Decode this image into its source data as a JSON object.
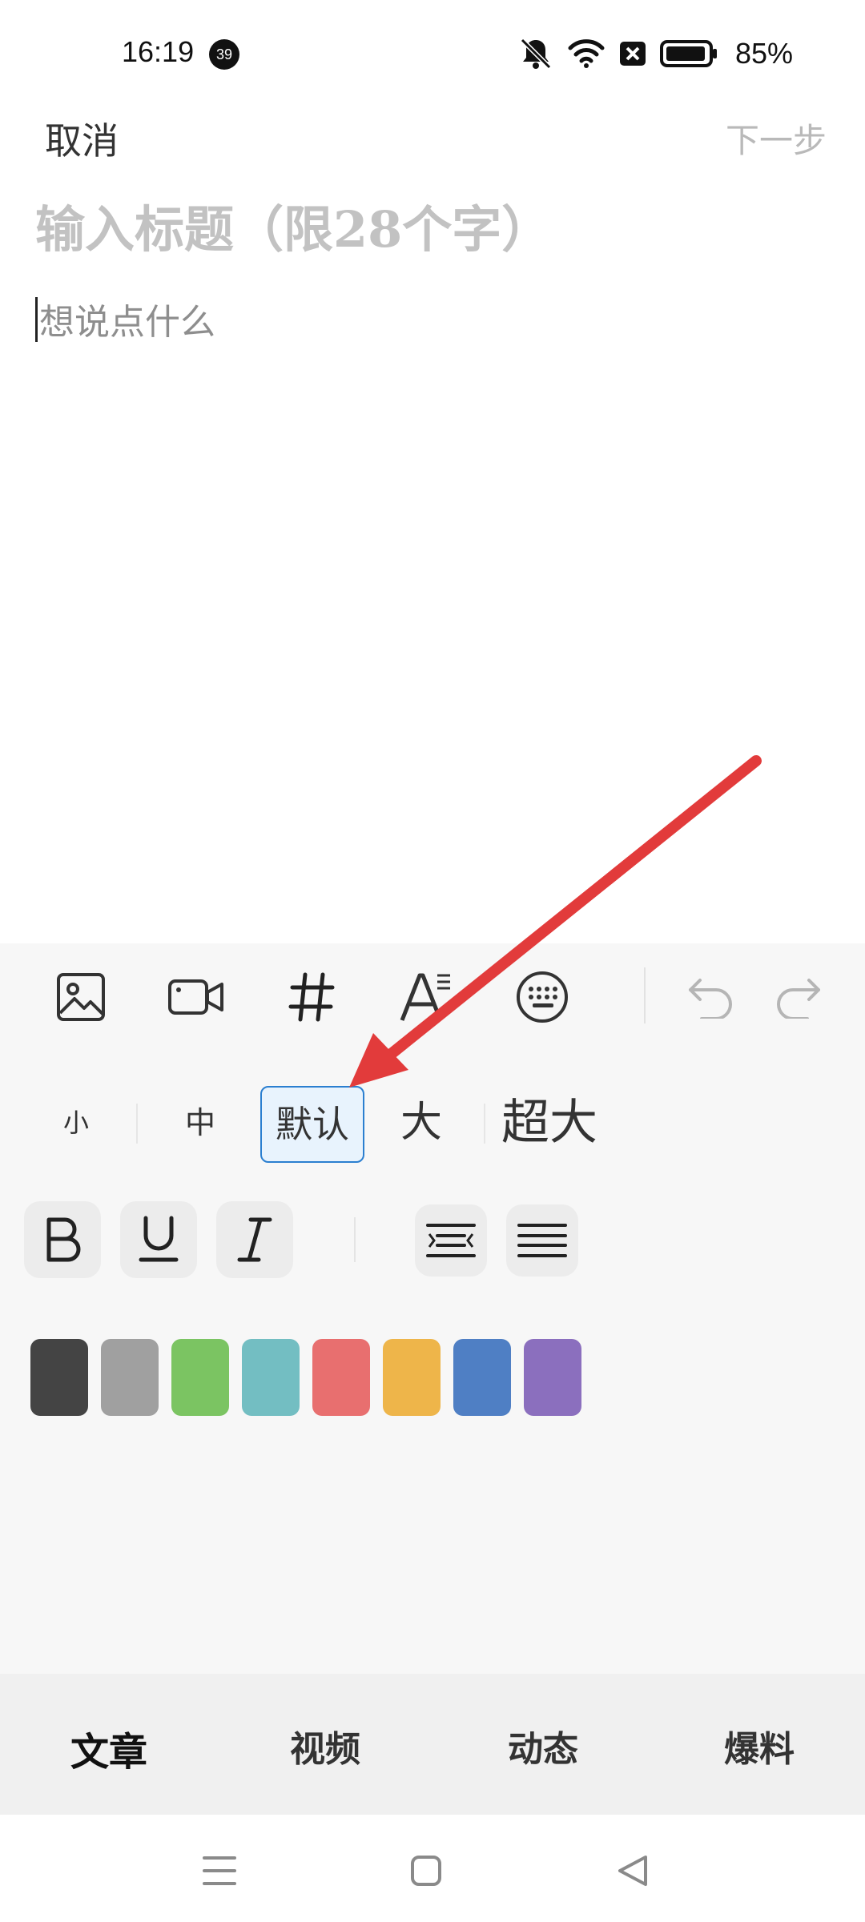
{
  "status_bar": {
    "time": "16:19",
    "notification_count": "39",
    "battery_percent": "85%"
  },
  "top_bar": {
    "cancel_label": "取消",
    "next_label": "下一步"
  },
  "editor": {
    "title_placeholder": "输入标题（限28个字）",
    "body_placeholder": "想说点什么"
  },
  "toolbar": {
    "icons": [
      "image-icon",
      "video-icon",
      "hashtag-icon",
      "font-format-icon",
      "keyboard-icon",
      "undo-icon",
      "redo-icon"
    ]
  },
  "font_sizes": {
    "items": [
      "小",
      "中",
      "默认",
      "大",
      "超大"
    ],
    "selected": "默认"
  },
  "format": {
    "buttons": [
      "bold-icon",
      "underline-icon",
      "italic-icon",
      "align-center-icon",
      "align-justify-icon"
    ]
  },
  "colors": [
    "#444444",
    "#a0a0a0",
    "#7bc462",
    "#73bec2",
    "#e86f6f",
    "#eeb54a",
    "#4f7fc4",
    "#8b6fbe"
  ],
  "tabs": {
    "items": [
      "文章",
      "视频",
      "动态",
      "爆料"
    ],
    "active": "文章"
  },
  "annotation": {
    "color": "#e23b3b"
  }
}
